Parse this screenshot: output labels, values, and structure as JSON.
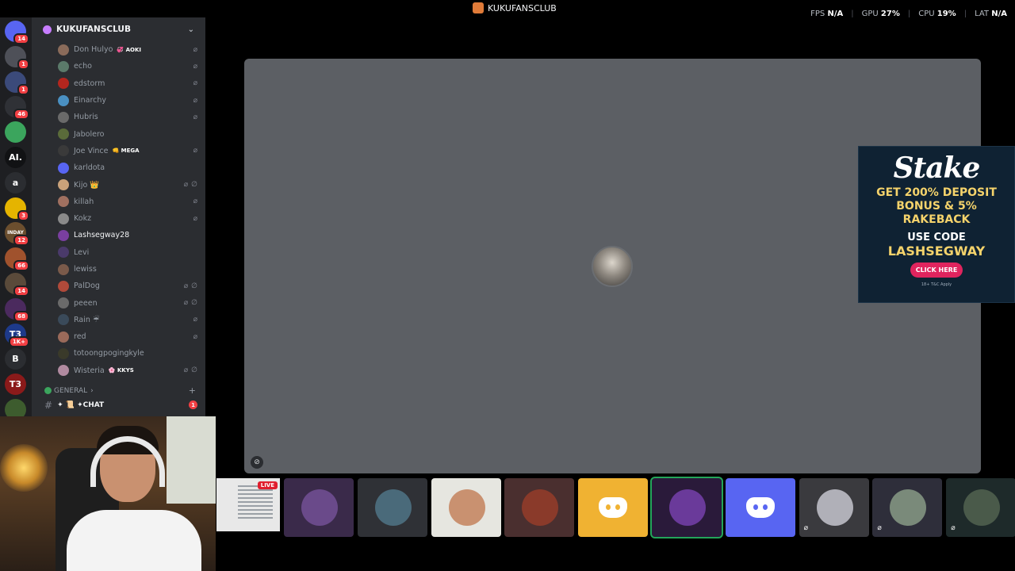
{
  "titlebar": {
    "title": "KUKUFANSCLUB",
    "perf": [
      {
        "label": "FPS",
        "value": "N/A"
      },
      {
        "label": "GPU",
        "value": "27%"
      },
      {
        "label": "CPU",
        "value": "19%"
      },
      {
        "label": "LAT",
        "value": "N/A"
      }
    ]
  },
  "servers": [
    {
      "label": "",
      "badge": "14",
      "color": "#5865f2"
    },
    {
      "label": "",
      "badge": "1",
      "color": "#4e5058"
    },
    {
      "label": "",
      "badge": "1",
      "color": "#3b4a7a"
    },
    {
      "label": "",
      "badge": "46",
      "color": "#2f3136"
    },
    {
      "label": "",
      "badge": "",
      "color": "#3ba55d"
    },
    {
      "label": "AI.",
      "badge": "",
      "color": "#111214"
    },
    {
      "label": "a",
      "badge": "",
      "color": "#2b2d31"
    },
    {
      "label": "",
      "badge": "3",
      "color": "#e5b400"
    },
    {
      "label": "INDAY",
      "badge": "12",
      "color": "#6b4e2e"
    },
    {
      "label": "",
      "badge": "66",
      "color": "#a0522d"
    },
    {
      "label": "",
      "badge": "14",
      "color": "#5a4a3a"
    },
    {
      "label": "",
      "badge": "68",
      "color": "#4b2a5e"
    },
    {
      "label": "T3",
      "badge": "1K+",
      "color": "#1e3a8a"
    },
    {
      "label": "B",
      "badge": "",
      "color": "#2b2d31"
    },
    {
      "label": "T3",
      "badge": "",
      "color": "#8b1a1a"
    },
    {
      "label": "",
      "badge": "",
      "color": "#3d5c2e"
    }
  ],
  "sidebar": {
    "server_name": "KUKUFANSCLUB",
    "members": [
      {
        "name": "Don Hulyo",
        "tag": "💞 AOKI",
        "muted": true,
        "deaf": false,
        "color": "#8a6b5a"
      },
      {
        "name": "echo",
        "tag": "",
        "muted": true,
        "deaf": false,
        "color": "#5b7a6a"
      },
      {
        "name": "edstorm",
        "tag": "",
        "muted": true,
        "deaf": false,
        "color": "#b3261e"
      },
      {
        "name": "Einarchy",
        "tag": "",
        "muted": true,
        "deaf": false,
        "color": "#4a90c2"
      },
      {
        "name": "Hubris",
        "tag": "",
        "muted": true,
        "deaf": false,
        "color": "#6a6a6a"
      },
      {
        "name": "Jabolero",
        "tag": "",
        "muted": false,
        "deaf": false,
        "color": "#5a6b3a"
      },
      {
        "name": "Joe Vince",
        "tag": "👊 MEGA",
        "muted": true,
        "deaf": false,
        "color": "#3a3a3a"
      },
      {
        "name": "karldota",
        "tag": "",
        "muted": false,
        "deaf": false,
        "color": "#5865f2"
      },
      {
        "name": "Kijo 👑",
        "tag": "",
        "muted": true,
        "deaf": true,
        "color": "#c9a27a"
      },
      {
        "name": "killah",
        "tag": "",
        "muted": true,
        "deaf": false,
        "color": "#a07060"
      },
      {
        "name": "Kokz",
        "tag": "",
        "muted": true,
        "deaf": false,
        "color": "#8a8a8a"
      },
      {
        "name": "Lashsegway28",
        "tag": "",
        "muted": false,
        "deaf": false,
        "color": "#7a3fa0",
        "active": true
      },
      {
        "name": "Levi",
        "tag": "",
        "muted": false,
        "deaf": false,
        "color": "#4a3a6a"
      },
      {
        "name": "lewiss",
        "tag": "",
        "muted": false,
        "deaf": false,
        "color": "#7a5a4a"
      },
      {
        "name": "PalDog",
        "tag": "",
        "muted": true,
        "deaf": true,
        "color": "#b04a3a"
      },
      {
        "name": "peeen",
        "tag": "",
        "muted": true,
        "deaf": true,
        "color": "#6a6a6a"
      },
      {
        "name": "Rain ☔",
        "tag": "",
        "muted": true,
        "deaf": false,
        "color": "#3a4a5a"
      },
      {
        "name": "red",
        "tag": "",
        "muted": true,
        "deaf": false,
        "color": "#9a6a5a"
      },
      {
        "name": "totoongpogingkyle",
        "tag": "",
        "muted": false,
        "deaf": false,
        "color": "#3a3a2a"
      },
      {
        "name": "Wisteria",
        "tag": "🌸 KKYS",
        "muted": true,
        "deaf": true,
        "color": "#b08aa0"
      }
    ],
    "category": "GENERAL",
    "channel": {
      "name": "✦ 📜 ✦CHAT",
      "mentions": "1"
    }
  },
  "ad": {
    "brand": "Stake",
    "promo_line1": "GET 200% DEPOSIT",
    "promo_line2": "BONUS & 5%",
    "promo_line3": "RAKEBACK",
    "use_code": "USE CODE",
    "code": "LASHSEGWAY",
    "cta": "CLICK HERE",
    "fine": "18+ T&C Apply"
  },
  "live_label": "LIVE",
  "participants": [
    {
      "kind": "avatar",
      "bg": "#3a2a4a",
      "avatar": "#6a4a8a",
      "muted": false
    },
    {
      "kind": "avatar",
      "bg": "#2f3136",
      "avatar": "#4a6a7a",
      "muted": false
    },
    {
      "kind": "avatar",
      "bg": "#e6e6e0",
      "avatar": "#c99170",
      "muted": false
    },
    {
      "kind": "avatar",
      "bg": "#4a2f2f",
      "avatar": "#8a3a2a",
      "muted": false
    },
    {
      "kind": "discord",
      "bg": "#f0b232",
      "muted": false
    },
    {
      "kind": "avatar",
      "bg": "#2a1a3a",
      "avatar": "#6a3a9a",
      "muted": false,
      "speaking": true
    },
    {
      "kind": "discord",
      "bg": "#5865f2",
      "muted": false
    },
    {
      "kind": "avatar",
      "bg": "#3a3a3e",
      "avatar": "#b0b0b8",
      "muted": true
    },
    {
      "kind": "avatar",
      "bg": "#2e2e3a",
      "avatar": "#7a8a7a",
      "muted": true
    },
    {
      "kind": "avatar",
      "bg": "#1e2a2a",
      "avatar": "#4a5a4a",
      "muted": true
    }
  ]
}
